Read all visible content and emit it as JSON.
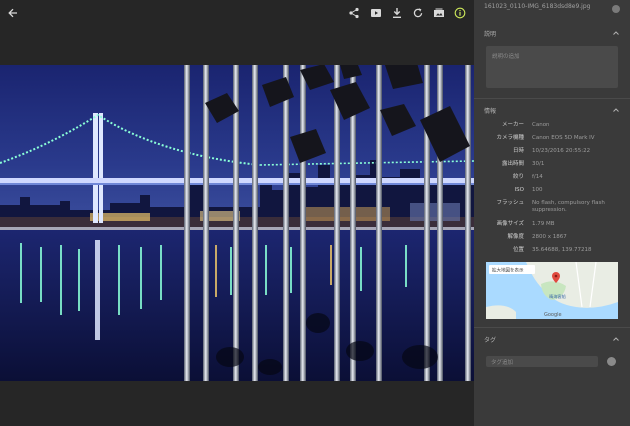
{
  "viewer": {
    "toolbar": {
      "back": "back-arrow-icon",
      "share": "share-icon",
      "slideshow": "slideshow-icon",
      "download": "download-icon",
      "rotate": "rotate-icon",
      "add_album": "add-to-album-icon",
      "info": "info-icon"
    },
    "info_color": "#cde85a"
  },
  "panel": {
    "filename": "161023_0110-IMG_6183dsd8e9.jpg",
    "description": {
      "label": "説明",
      "placeholder": "説明の追加"
    },
    "info": {
      "label": "情報",
      "rows": [
        {
          "key": "メーカー",
          "value": "Canon"
        },
        {
          "key": "カメラ機種",
          "value": "Canon EOS 5D Mark IV"
        },
        {
          "key": "日時",
          "value": "10/23/2016 20:55:22"
        },
        {
          "key": "露出時間",
          "value": "30/1"
        },
        {
          "key": "絞り",
          "value": "f/14"
        },
        {
          "key": "ISO",
          "value": "100"
        },
        {
          "key": "フラッシュ",
          "value": "No flash, compulsory flash suppression."
        },
        {
          "key": "画像サイズ",
          "value": "1.79 MB"
        },
        {
          "key": "解像度",
          "value": "2800 x 1867"
        },
        {
          "key": "位置",
          "value": "35.64688, 139.77218"
        }
      ]
    },
    "map": {
      "button": "拡大地図を表示",
      "place": "晴海客船",
      "brand": "Google"
    },
    "tags": {
      "label": "タグ",
      "placeholder": "タグ追加"
    }
  }
}
